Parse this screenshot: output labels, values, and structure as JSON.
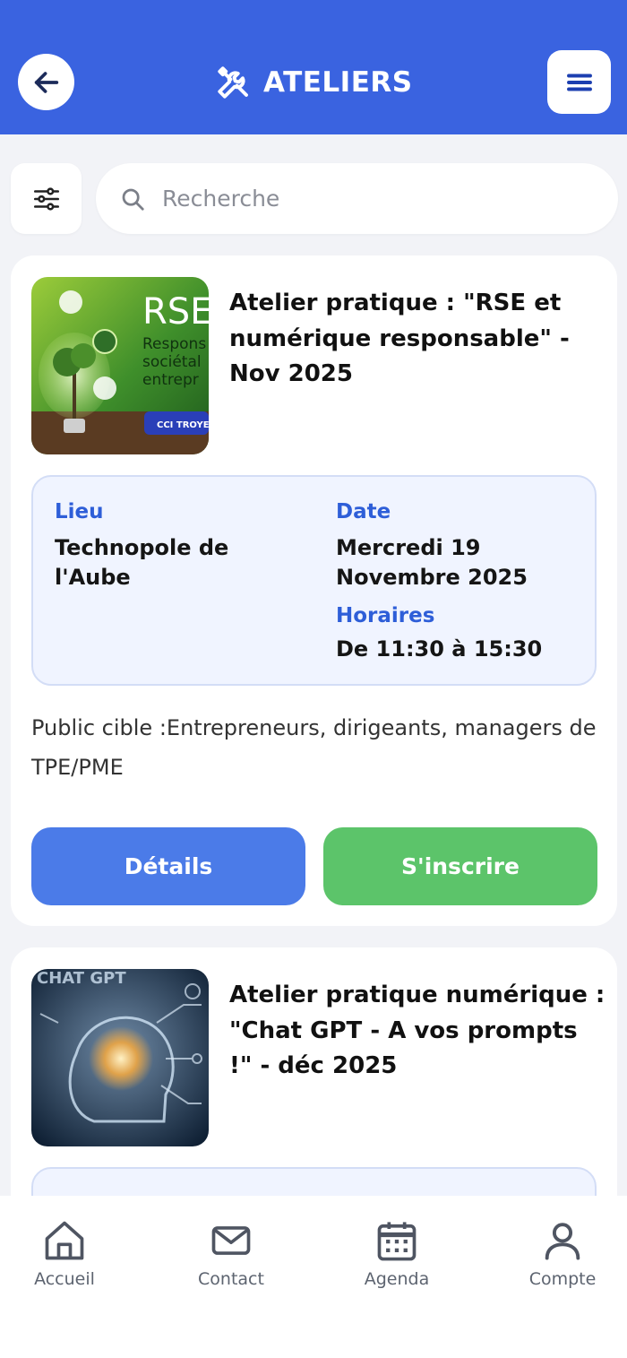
{
  "header": {
    "title": "ATELIERS"
  },
  "search": {
    "placeholder": "Recherche"
  },
  "workshops": [
    {
      "title": "Atelier pratique : \"RSE et numérique responsable\" - Nov 2025",
      "thumb_text": {
        "big": "RSE",
        "line1": "Respons",
        "line2": "sociétal",
        "line3": "entrepr",
        "badge": "CCI TROYE"
      },
      "lieu_label": "Lieu",
      "lieu": "Technopole de l'Aube",
      "date_label": "Date",
      "date": "Mercredi 19 Novembre 2025",
      "horaires_label": "Horaires",
      "horaires": "De 11:30 à 15:30",
      "audience": " Public cible :Entrepreneurs, dirigeants, managers de TPE/PME",
      "details_label": "Détails",
      "signup_label": "S'inscrire"
    },
    {
      "title": "Atelier pratique numérique : \"Chat GPT - A vos prompts !\" - déc 2025",
      "thumb_text": {
        "big": "CHAT GPT"
      }
    }
  ],
  "nav": {
    "items": [
      {
        "label": "Accueil",
        "icon": "home-icon"
      },
      {
        "label": "Contact",
        "icon": "mail-icon"
      },
      {
        "label": "Agenda",
        "icon": "calendar-icon"
      },
      {
        "label": "Compte",
        "icon": "user-icon"
      }
    ]
  },
  "colors": {
    "header": "#3a63e0",
    "details_button": "#4b7be8",
    "signup_button": "#5cc46a",
    "label_blue": "#2e5ed8"
  }
}
